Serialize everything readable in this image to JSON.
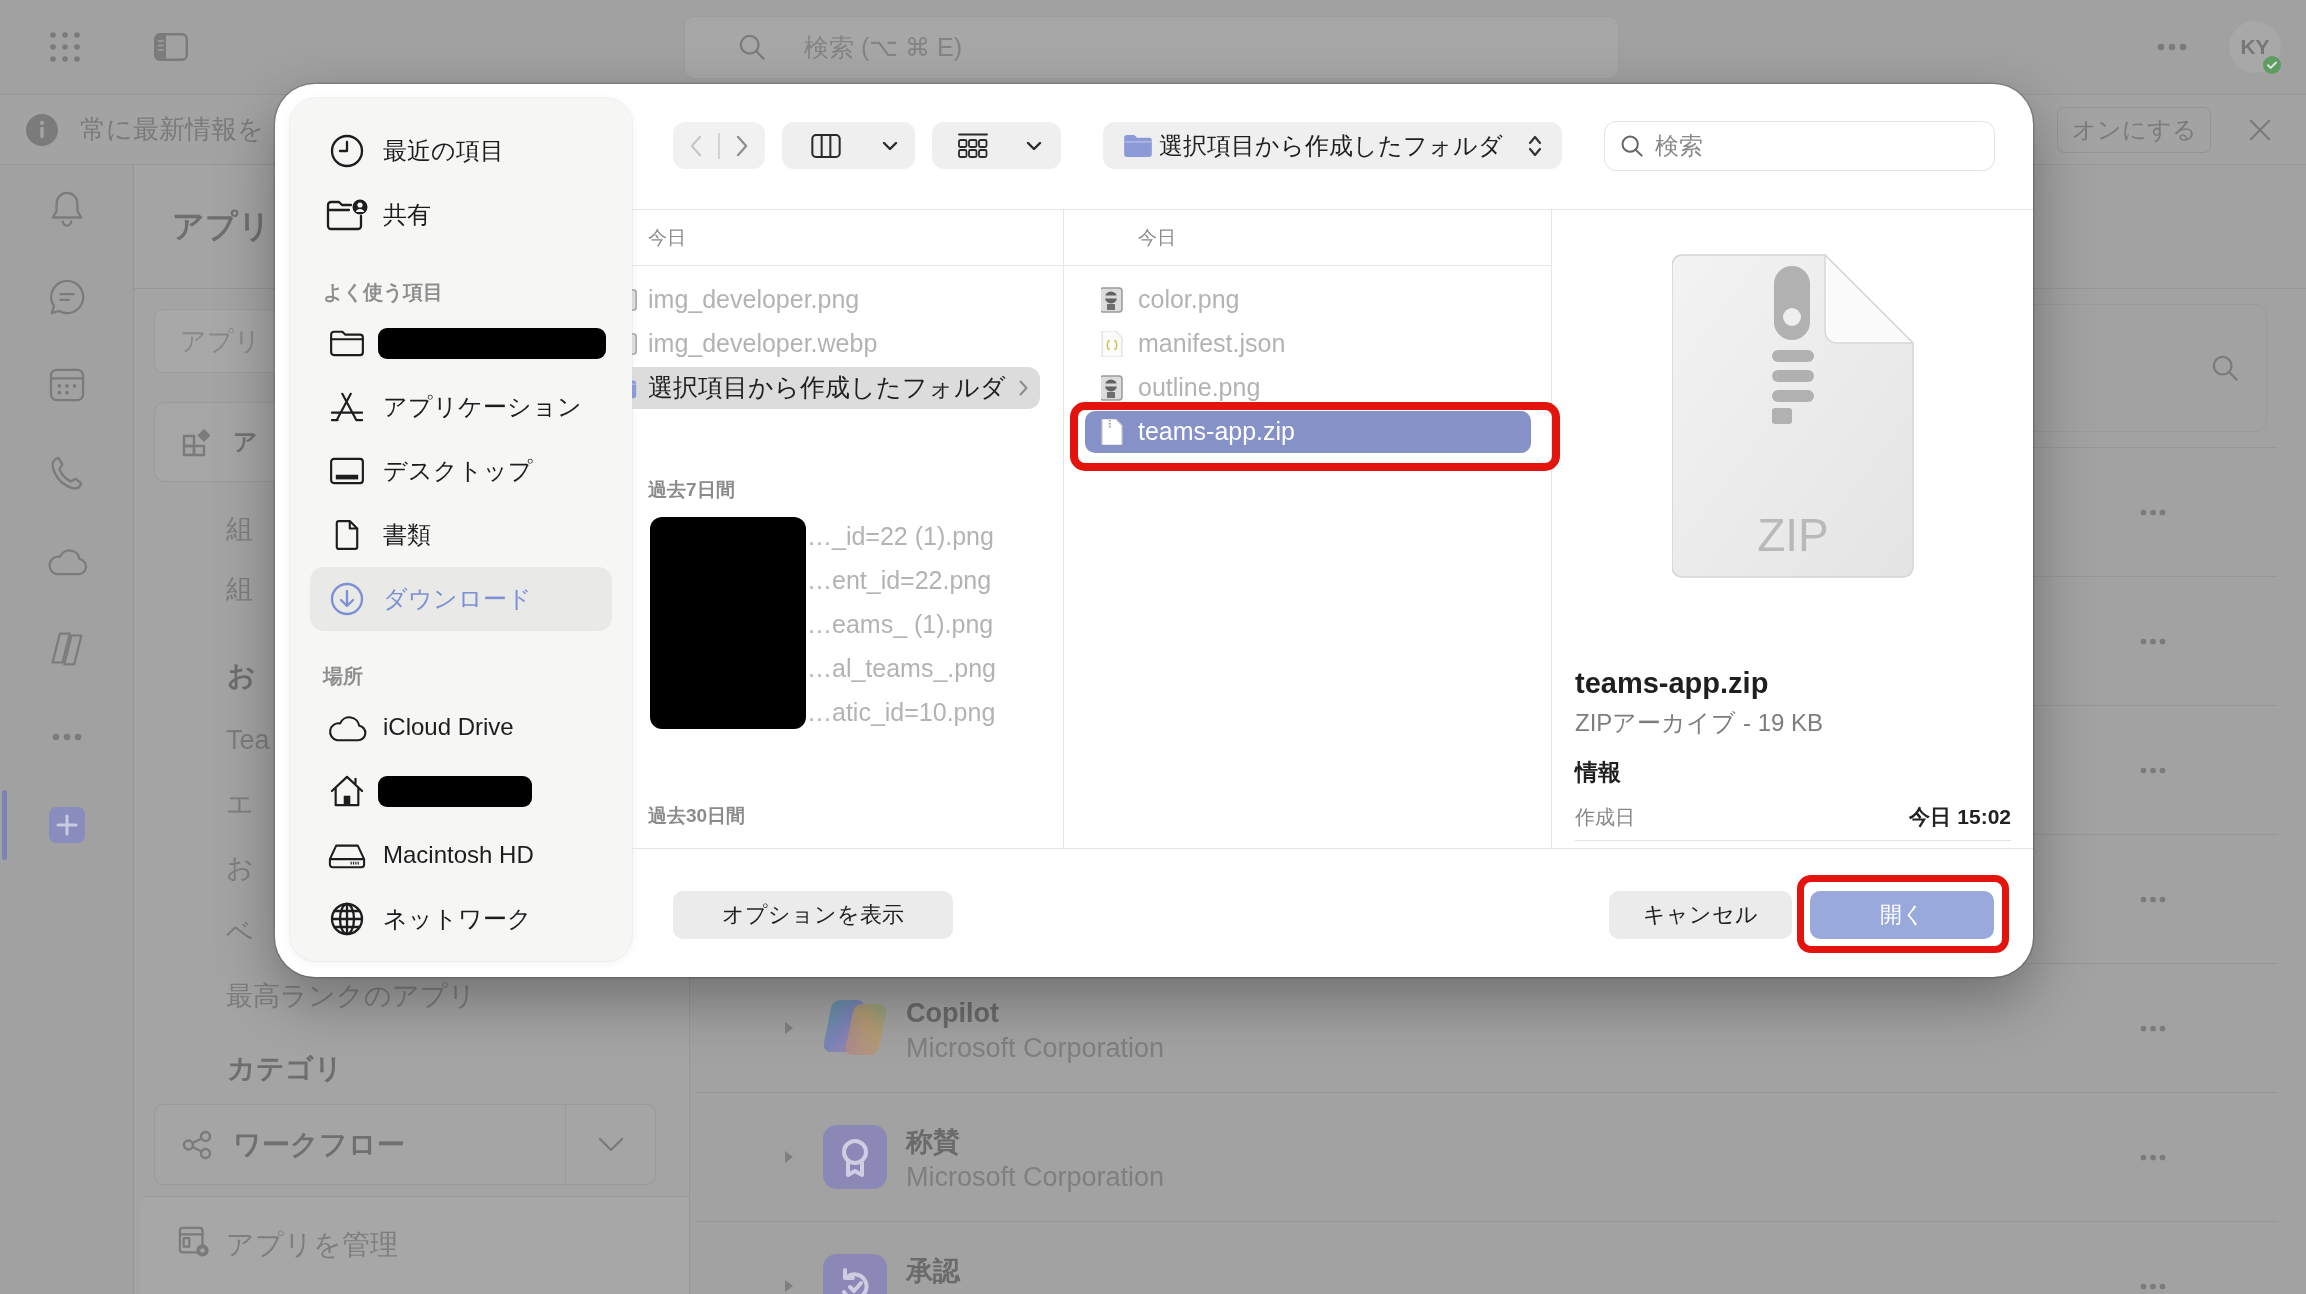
{
  "app": {
    "top_bar": {
      "search": {
        "placeholder": "検索 (⌥ ⌘ E)"
      },
      "avatar": {
        "initials": "KY",
        "available": true
      }
    },
    "banner": {
      "text": "常に最新情報を",
      "button": "オンにする"
    },
    "rail": [
      {
        "selected": false
      },
      {
        "selected": false
      },
      {
        "selected": false
      },
      {
        "selected": false
      },
      {
        "selected": false
      },
      {
        "selected": false
      },
      {
        "selected": false
      },
      {
        "selected": true
      }
    ],
    "apps_panel": {
      "title": "アプリ",
      "search": {
        "placeholder": "アプリ"
      },
      "featured": "ア",
      "links": [
        "組",
        "組"
      ],
      "sections": [
        {
          "heading": "お",
          "links": [
            "Tea",
            "エ",
            "お",
            "ベ",
            "最高ランクのアプリ"
          ]
        }
      ],
      "categories": {
        "heading": "カテゴリ",
        "dropdown": "ワークフロー"
      },
      "manage": "アプリを管理"
    },
    "list": {
      "rows": [
        {
          "kind": "covered"
        },
        {
          "kind": "covered"
        },
        {
          "kind": "covered"
        },
        {
          "kind": "covered"
        },
        {
          "kind": "app",
          "name": "Copilot",
          "publisher": "Microsoft Corporation"
        },
        {
          "kind": "app",
          "name": "称賛",
          "publisher": "Microsoft Corporation"
        },
        {
          "kind": "app",
          "name": "承認"
        }
      ]
    }
  },
  "dialog": {
    "sidebar": {
      "sections": [
        {
          "items": [
            {
              "kind": "label",
              "label": "最近の項目",
              "selected": false
            },
            {
              "kind": "label",
              "label": "共有",
              "selected": false
            }
          ]
        },
        {
          "heading": "よく使う項目",
          "items": [
            {
              "kind": "redacted",
              "selected": false
            },
            {
              "kind": "label",
              "label": "アプリケーション",
              "selected": false
            },
            {
              "kind": "label",
              "label": "デスクトップ",
              "selected": false
            },
            {
              "kind": "label",
              "label": "書類",
              "selected": false
            },
            {
              "kind": "label",
              "label": "ダウンロード",
              "selected": true
            }
          ]
        },
        {
          "heading": "場所",
          "items": [
            {
              "kind": "label",
              "label": "iCloud Drive",
              "selected": false
            },
            {
              "kind": "redacted",
              "selected": false
            },
            {
              "kind": "label",
              "label": "Macintosh HD",
              "selected": false
            },
            {
              "kind": "label",
              "label": "ネットワーク",
              "selected": false
            }
          ]
        }
      ]
    },
    "toolbar": {
      "navigation": [
        {
          "disabled": true
        },
        {
          "disabled": false
        }
      ],
      "path": "選択項目から作成したフォルダ",
      "search": {
        "placeholder": "検索"
      }
    },
    "columns": [
      {
        "header": "今日",
        "focused": false,
        "groups": [
          {
            "redacted": false,
            "items": [
              {
                "kind": "image",
                "name": "img_developer.png",
                "disabled": true,
                "selected": false,
                "annotated": false
              },
              {
                "kind": "image",
                "name": "img_developer.webp",
                "disabled": true,
                "selected": false,
                "annotated": false
              },
              {
                "kind": "folder",
                "name": "選択項目から作成したフォルダ",
                "disabled": false,
                "selected": true,
                "annotated": false
              }
            ]
          },
          {
            "heading": "過去7日間",
            "redacted": true,
            "items": [
              {
                "kind": "image",
                "name": "…_id=22 (1).png",
                "disabled": true,
                "selected": false,
                "annotated": false
              },
              {
                "kind": "image",
                "name": "…ent_id=22.png",
                "disabled": true,
                "selected": false,
                "annotated": false
              },
              {
                "kind": "image",
                "name": "…eams_ (1).png",
                "disabled": true,
                "selected": false,
                "annotated": false
              },
              {
                "kind": "image",
                "name": "…al_teams_.png",
                "disabled": true,
                "selected": false,
                "annotated": false
              },
              {
                "kind": "image",
                "name": "…atic_id=10.png",
                "disabled": true,
                "selected": false,
                "annotated": false
              }
            ]
          },
          {
            "heading": "過去30日間",
            "redacted": false
          }
        ]
      },
      {
        "header": "今日",
        "focused": true,
        "groups": [
          {
            "redacted": false,
            "items": [
              {
                "kind": "image",
                "name": "color.png",
                "disabled": true,
                "selected": false,
                "annotated": false
              },
              {
                "kind": "json",
                "name": "manifest.json",
                "disabled": true,
                "selected": false,
                "annotated": false
              },
              {
                "kind": "image",
                "name": "outline.png",
                "disabled": true,
                "selected": false,
                "annotated": false
              },
              {
                "kind": "zip",
                "name": "teams-app.zip",
                "disabled": false,
                "selected": true,
                "annotated": true
              }
            ]
          }
        ]
      }
    ],
    "preview": {
      "icon_label": "ZIP",
      "name": "teams-app.zip",
      "summary": "ZIPアーカイブ - 19 KB",
      "info_heading": "情報",
      "info": [
        {
          "label": "作成日",
          "value": "今日 15:02"
        }
      ]
    },
    "footer": {
      "options_button": "オプションを表示",
      "buttons": [
        {
          "kind": "secondary",
          "label": "キャンセル",
          "annotated": false
        },
        {
          "kind": "primary",
          "label": "開く",
          "annotated": true
        }
      ]
    }
  }
}
